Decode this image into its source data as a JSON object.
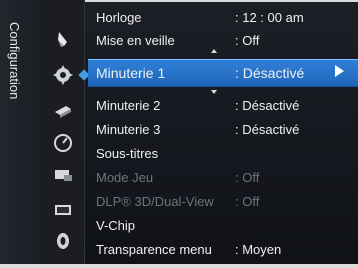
{
  "sidebar": {
    "category_label": "Configuration",
    "icons": [
      "picture-icon",
      "setup-gear-icon",
      "input-icon",
      "timer-dial-icon",
      "application-icon",
      "support-icon",
      "sound-icon"
    ]
  },
  "menu": {
    "items": [
      {
        "label": "Horloge",
        "value": ": 12 : 00 am"
      },
      {
        "label": "Mise en veille",
        "value": ": Off"
      },
      {
        "label": "Minuterie 1",
        "value": ": Désactivé",
        "selected": true
      },
      {
        "label": "Minuterie 2",
        "value": ": Désactivé"
      },
      {
        "label": "Minuterie 3",
        "value": ": Désactivé"
      },
      {
        "label": "Sous-titres",
        "value": ""
      },
      {
        "label": "Mode Jeu",
        "value": ": Off",
        "disabled": true
      },
      {
        "label": "DLP® 3D/Dual-View",
        "value": ": Off",
        "disabled": true
      },
      {
        "label": "V-Chip",
        "value": ""
      },
      {
        "label": "Transparence menu",
        "value": ": Moyen"
      }
    ]
  },
  "colors": {
    "highlight": "#2f7fd7",
    "text": "#f0f0f0",
    "disabled_text": "#6f737b"
  }
}
